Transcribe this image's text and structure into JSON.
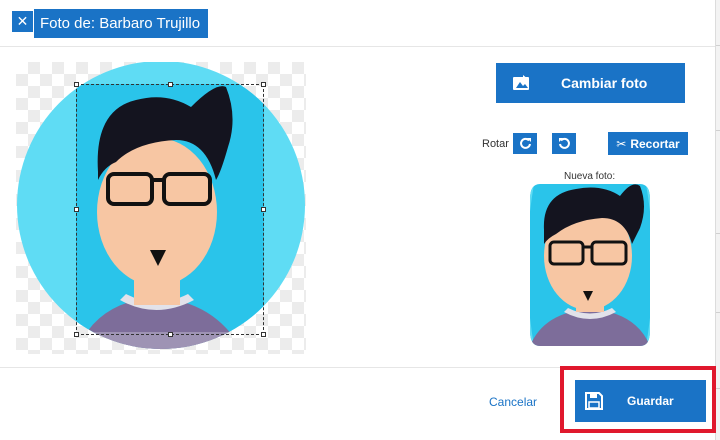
{
  "dialog": {
    "title": "Foto de: Barbaro Trujillo",
    "close_icon": "close-icon"
  },
  "actions": {
    "change_photo": "Cambiar foto",
    "rotate_label": "Rotar",
    "crop": "Recortar",
    "new_photo_label": "Nueva foto:"
  },
  "footer": {
    "cancel": "Cancelar",
    "save": "Guardar"
  },
  "colors": {
    "accent": "#1a73c6",
    "highlight": "#e0182d",
    "avatar_bg": "#5fdcf4"
  }
}
